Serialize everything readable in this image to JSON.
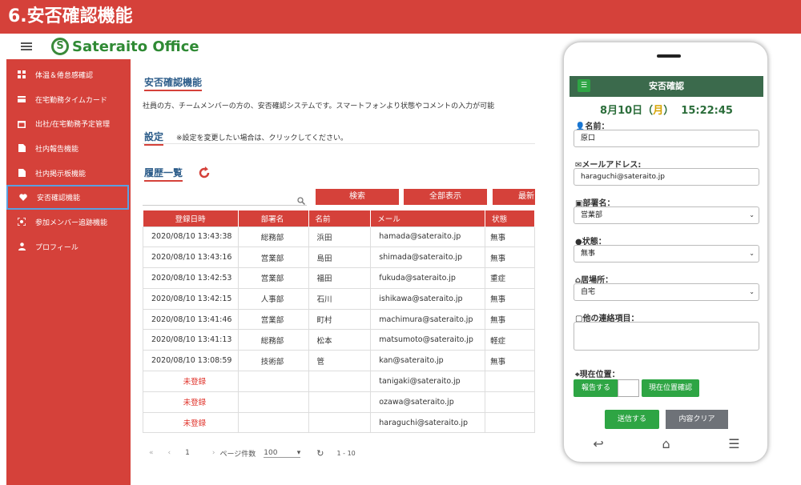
{
  "banner": {
    "title": "6.安否確認機能"
  },
  "brand": {
    "logo_letter": "S",
    "name": "Sateraito Office"
  },
  "sidebar": {
    "items": [
      {
        "label": "体温＆倦怠感確認",
        "icon": "grid-icon"
      },
      {
        "label": "在宅勤務タイムカード",
        "icon": "card-icon"
      },
      {
        "label": "出社/在宅勤務予定管理",
        "icon": "calendar-icon"
      },
      {
        "label": "社内報告機能",
        "icon": "document-icon"
      },
      {
        "label": "社内掲示板機能",
        "icon": "document-icon"
      },
      {
        "label": "安否確認機能",
        "icon": "heart-icon",
        "active": true
      },
      {
        "label": "参加メンバー追跡機能",
        "icon": "scan-icon"
      },
      {
        "label": "プロフィール",
        "icon": "person-icon"
      }
    ]
  },
  "main": {
    "title": "安否確認機能",
    "description": "社員の方、チームメンバーの方の、安否確認システムです。スマートフォンより状態やコメントの入力が可能",
    "settings_title": "設定",
    "settings_note": "※設定を変更したい場合は、クリックしてください。",
    "history_title": "履歴一覧",
    "buttons": {
      "search": "検索",
      "show_all": "全部表示",
      "latest": "最新"
    },
    "table": {
      "headers": [
        "登録日時",
        "部署名",
        "名前",
        "メール",
        "状態"
      ],
      "rows": [
        [
          "2020/08/10 13:43:38",
          "総務部",
          "浜田",
          "hamada@sateraito.jp",
          "無事"
        ],
        [
          "2020/08/10 13:43:16",
          "営業部",
          "島田",
          "shimada@sateraito.jp",
          "無事"
        ],
        [
          "2020/08/10 13:42:53",
          "営業部",
          "福田",
          "fukuda@sateraito.jp",
          "重症"
        ],
        [
          "2020/08/10 13:42:15",
          "人事部",
          "石川",
          "ishikawa@sateraito.jp",
          "無事"
        ],
        [
          "2020/08/10 13:41:46",
          "営業部",
          "町村",
          "machimura@sateraito.jp",
          "無事"
        ],
        [
          "2020/08/10 13:41:13",
          "総務部",
          "松本",
          "matsumoto@sateraito.jp",
          "軽症"
        ],
        [
          "2020/08/10 13:08:59",
          "技術部",
          "管",
          "kan@sateraito.jp",
          "無事"
        ],
        [
          "未登録",
          "",
          "",
          "tanigaki@sateraito.jp",
          ""
        ],
        [
          "未登録",
          "",
          "",
          "ozawa@sateraito.jp",
          ""
        ],
        [
          "未登録",
          "",
          "",
          "haraguchi@sateraito.jp",
          ""
        ]
      ]
    },
    "pager": {
      "page": "1",
      "per_page_label": "ページ件数",
      "per_page": "100",
      "range": "1 - 10"
    }
  },
  "phone": {
    "header": "安否確認",
    "date_prefix": "8月10日（",
    "date_weekday": "月",
    "date_suffix": "）",
    "time": "15:22:45",
    "name_label": "名前：",
    "name_value": "原口",
    "email_label": "メールアドレス:",
    "email_value": "haraguchi@sateraito.jp",
    "dept_label": "部署名：",
    "dept_value": "営業部",
    "status_label": "状態：",
    "status_value": "無事",
    "location_label": "居場所：",
    "location_value": "自宅",
    "other_label": "他の連絡項目：",
    "position_label": "現在位置：",
    "report_button": "報告する",
    "check_position_button": "現在位置確認",
    "send_button": "送信する",
    "clear_button": "内容クリア"
  }
}
